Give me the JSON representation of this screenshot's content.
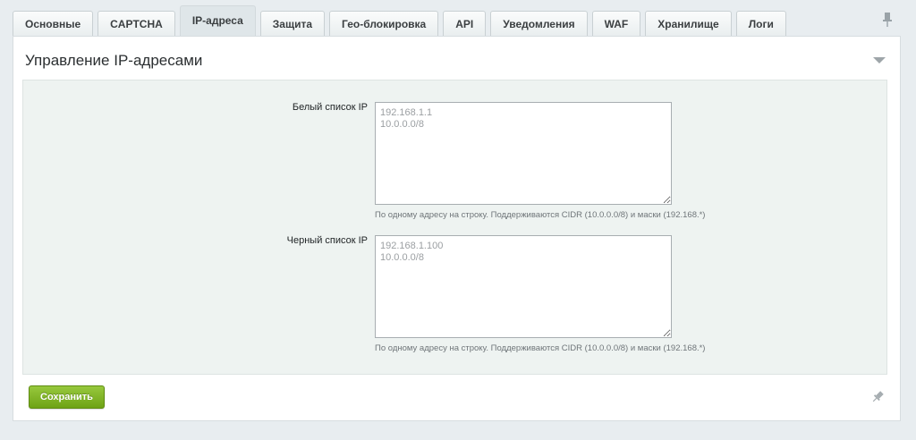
{
  "tabs": [
    {
      "label": "Основные",
      "active": false
    },
    {
      "label": "CAPTCHA",
      "active": false
    },
    {
      "label": "IP-адреса",
      "active": true
    },
    {
      "label": "Защита",
      "active": false
    },
    {
      "label": "Гео-блокировка",
      "active": false
    },
    {
      "label": "API",
      "active": false
    },
    {
      "label": "Уведомления",
      "active": false
    },
    {
      "label": "WAF",
      "active": false
    },
    {
      "label": "Хранилище",
      "active": false
    },
    {
      "label": "Логи",
      "active": false
    }
  ],
  "panel": {
    "title": "Управление IP-адресами"
  },
  "whitelist": {
    "label": "Белый список IP",
    "placeholder": "192.168.1.1\n10.0.0.0/8",
    "value": "",
    "hint": "По одному адресу на строку. Поддерживаются CIDR (10.0.0.0/8) и маски (192.168.*)"
  },
  "blacklist": {
    "label": "Черный список IP",
    "placeholder": "192.168.1.100\n10.0.0.0/8",
    "value": "",
    "hint": "По одному адресу на строку. Поддерживаются CIDR (10.0.0.0/8) и маски (192.168.*)"
  },
  "actions": {
    "save_label": "Сохранить"
  },
  "icons": {
    "pin_top": "pin-icon",
    "collapse": "chevron-down-icon",
    "pin_bottom": "pin-icon"
  },
  "colors": {
    "save_button": "#7bb021",
    "form_background": "#eef3f1",
    "page_background": "#e8edf0"
  }
}
